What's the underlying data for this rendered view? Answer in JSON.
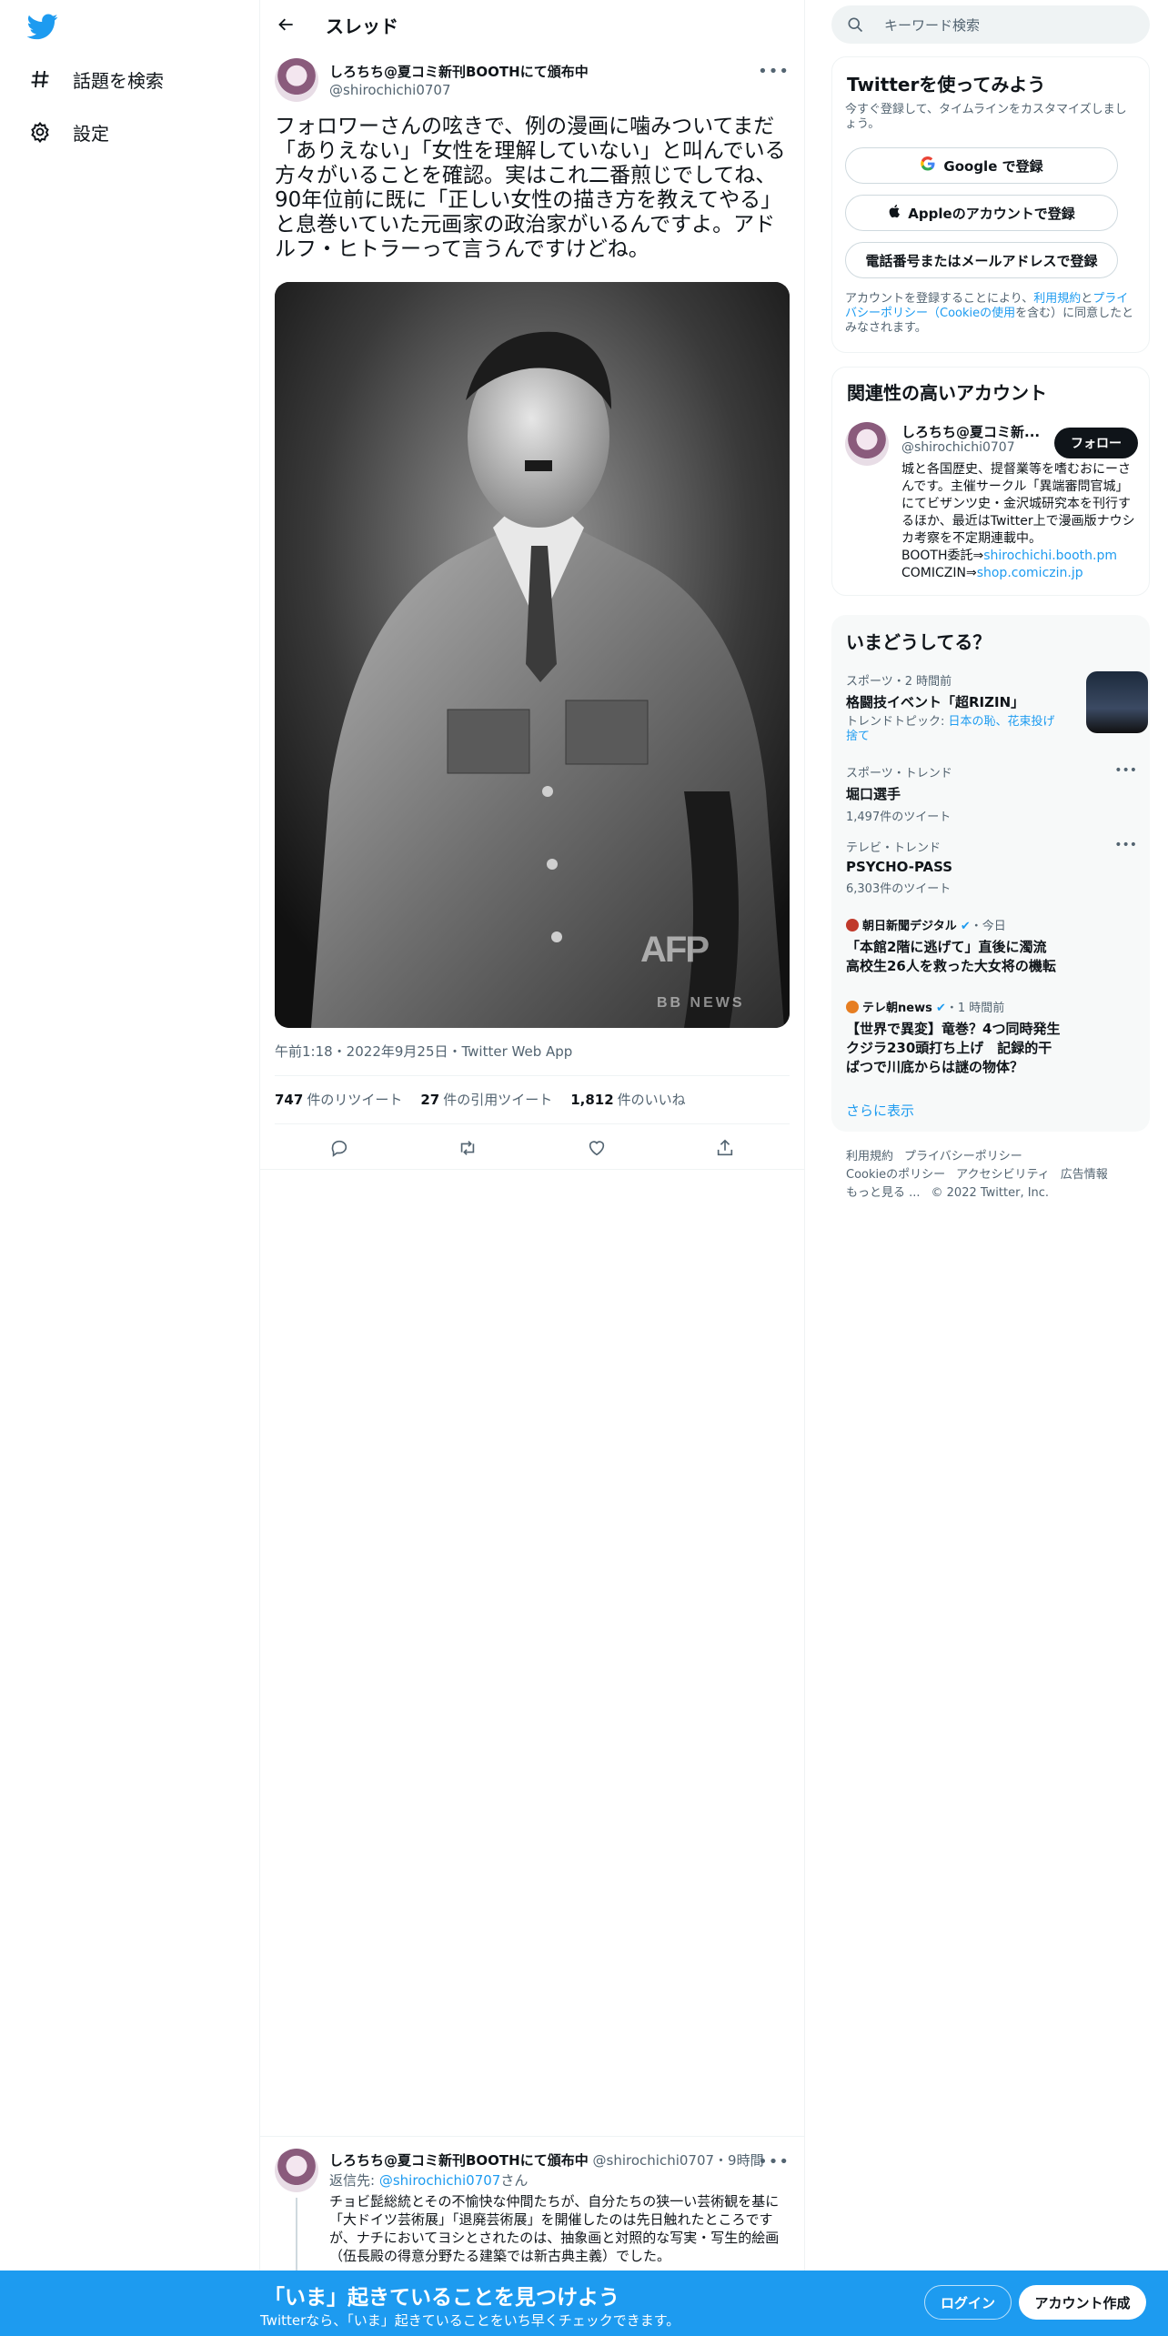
{
  "nav": {
    "explore_label": "話題を検索",
    "settings_label": "設定"
  },
  "header": {
    "title": "スレッド"
  },
  "tweet": {
    "author_name": "しろちち@夏コミ新刊BOOTHにて頒布中",
    "author_handle": "@shirochichi0707",
    "text": "フォロワーさんの呟きで、例の漫画に噛みついてまだ「ありえない」「女性を理解していない」と叫んでいる方々がいることを確認。実はこれ二番煎じでしてね、90年位前に既に「正しい女性の描き方を教えてやる」と息巻いていた元画家の政治家がいるんですよ。アドルフ・ヒトラーって言うんですけどね。",
    "media_watermark": "AFP",
    "media_watermark_sub": "BB NEWS",
    "timestamp": "午前1:18・2022年9月25日・Twitter Web App",
    "retweets_count": "747",
    "retweets_label": "件のリツイート",
    "quotes_count": "27",
    "quotes_label": "件の引用ツイート",
    "likes_count": "1,812",
    "likes_label": "件のいいね"
  },
  "reply": {
    "author_name": "しろちち@夏コミ新刊BOOTHにて頒布中",
    "author_handle": "@shirochichi0707",
    "time": "・9時間",
    "reply_to_prefix": "返信先: ",
    "reply_to_handle": "@shirochichi0707",
    "reply_to_suffix": "さん",
    "text": "チョビ髭総統とその不愉快な仲間たちが、自分たちの狭一い芸術観を基に「大ドイツ芸術展」「退廃芸術展」を開催したのは先日触れたところですが、ナチにおいてヨシとされたのは、抽象画と対照的な写実・写生的絵画（伍長殿の得意分野たる建築では新古典主義）でした。"
  },
  "right": {
    "search_placeholder": "キーワード検索",
    "signup": {
      "title": "Twitterを使ってみよう",
      "subtitle": "今すぐ登録して、タイムラインをカスタマイズしましょう。",
      "google_label": "Google で登録",
      "apple_label": "Appleのアカウントで登録",
      "phone_label": "電話番号またはメールアドレスで登録",
      "terms_prefix": "アカウントを登録することにより、",
      "terms_link": "利用規約",
      "terms_mid": "と",
      "privacy_link": "プライバシーポリシー（Cookieの使用",
      "terms_suffix": "を含む）に同意したとみなされます。"
    },
    "related": {
      "title": "関連性の高いアカウント",
      "name": "しろちち@夏コミ新...",
      "handle": "@shirochichi0707",
      "follow_label": "フォロー",
      "bio": "城と各国歴史、提督業等を嗜むおにーさんです。主催サークル「異端審問官城」にてビザンツ史・金沢城研究本を刊行するほか、最近はTwitter上で漫画版ナウシカ考察を不定期連載中。",
      "bio_booth_prefix": "BOOTH委託⇒",
      "bio_booth_link": "shirochichi.booth.pm",
      "bio_comic_prefix": "COMICZIN⇒",
      "bio_comic_link": "shop.comiczin.jp"
    },
    "trends": {
      "title": "いまどうしてる？",
      "items": [
        {
          "category": "スポーツ・2 時間前",
          "title": "格闘技イベント「超RIZIN」",
          "topic_prefix": "トレンドトピック: ",
          "topic_links": "日本の恥、花束投げ捨て"
        },
        {
          "category": "スポーツ・トレンド",
          "title": "堀口選手",
          "count": "1,497件のツイート"
        },
        {
          "category": "テレビ・トレンド",
          "title": "PSYCHO-PASS",
          "count": "6,303件のツイート"
        },
        {
          "source": "朝日新聞デジタル",
          "source_time": "・今日",
          "title": "「本館2階に逃げて」直後に濁流　高校生26人を救った大女将の機転"
        },
        {
          "source": "テレ朝news",
          "source_time": "・1 時間前",
          "title": "【世界で異変】竜巻？4つ同時発生　クジラ230頭打ち上げ　記録的干ばつで川底からは謎の物体？"
        }
      ],
      "show_more": "さらに表示"
    },
    "footer": {
      "terms": "利用規約",
      "privacy": "プライバシーポリシー",
      "cookie": "Cookieのポリシー",
      "accessibility": "アクセシビリティ",
      "ads": "広告情報",
      "more": "もっと見る ...",
      "copyright": "© 2022 Twitter, Inc."
    }
  },
  "bottom_bar": {
    "title": "「いま」起きていることを見つけよう",
    "subtitle": "Twitterなら、「いま」起きていることをいち早くチェックできます。",
    "login_label": "ログイン",
    "signup_label": "アカウント作成"
  },
  "colors": {
    "accent": "#1d9bf0",
    "text": "#0f1419",
    "muted": "#536471",
    "border": "#eff3f4"
  }
}
